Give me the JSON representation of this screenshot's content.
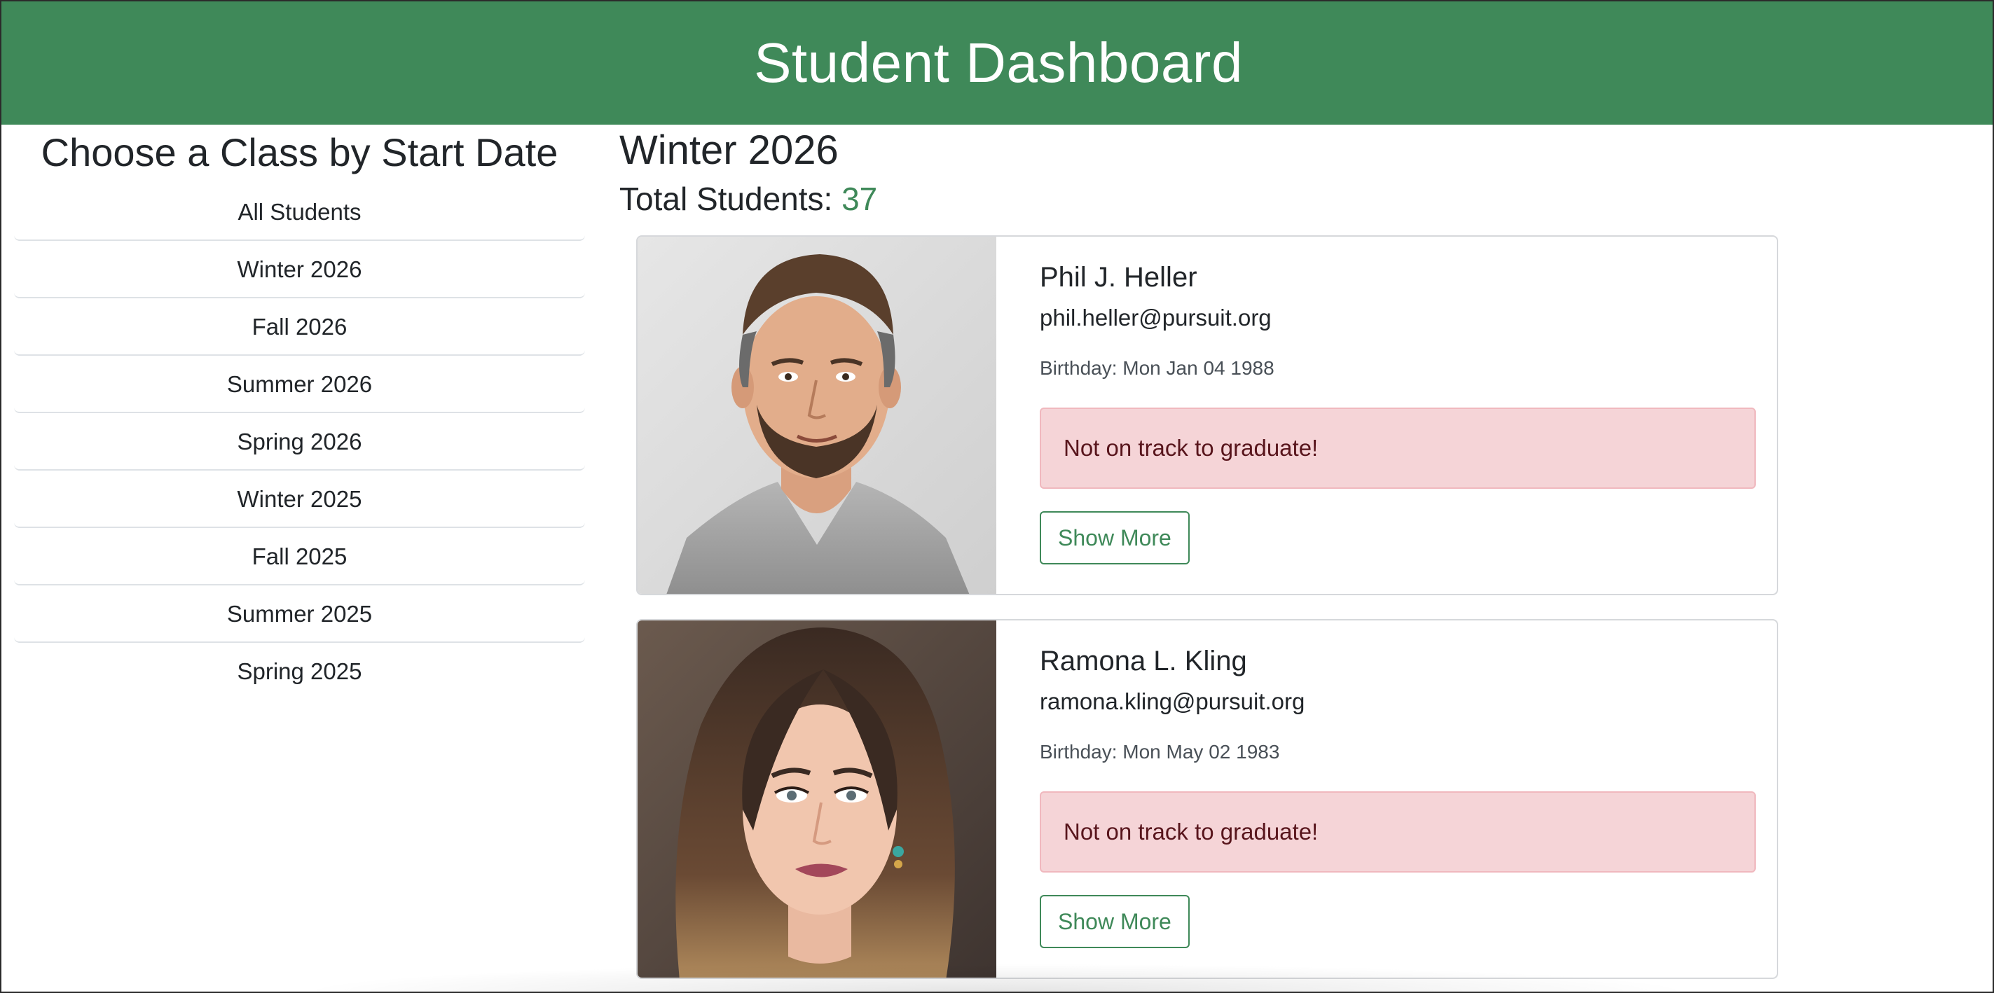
{
  "header": {
    "title": "Student Dashboard"
  },
  "sidebar": {
    "title": "Choose a Class by Start Date",
    "items": [
      {
        "label": "All Students"
      },
      {
        "label": "Winter 2026"
      },
      {
        "label": "Fall 2026"
      },
      {
        "label": "Summer 2026"
      },
      {
        "label": "Spring 2026"
      },
      {
        "label": "Winter 2025"
      },
      {
        "label": "Fall 2025"
      },
      {
        "label": "Summer 2025"
      },
      {
        "label": "Spring 2025"
      }
    ]
  },
  "main": {
    "cohort_title": "Winter 2026",
    "total_label": "Total Students:",
    "total_count": "37",
    "students": [
      {
        "name": "Phil J. Heller",
        "email": "phil.heller@pursuit.org",
        "birthday": "Birthday: Mon Jan 04 1988",
        "status": "Not on track to graduate!",
        "button": "Show More"
      },
      {
        "name": "Ramona L. Kling",
        "email": "ramona.kling@pursuit.org",
        "birthday": "Birthday: Mon May 02 1983",
        "status": "Not on track to graduate!",
        "button": "Show More"
      }
    ]
  },
  "colors": {
    "brand": "#3f8959",
    "alert_bg": "#f5d4d7",
    "alert_text": "#58151c"
  }
}
